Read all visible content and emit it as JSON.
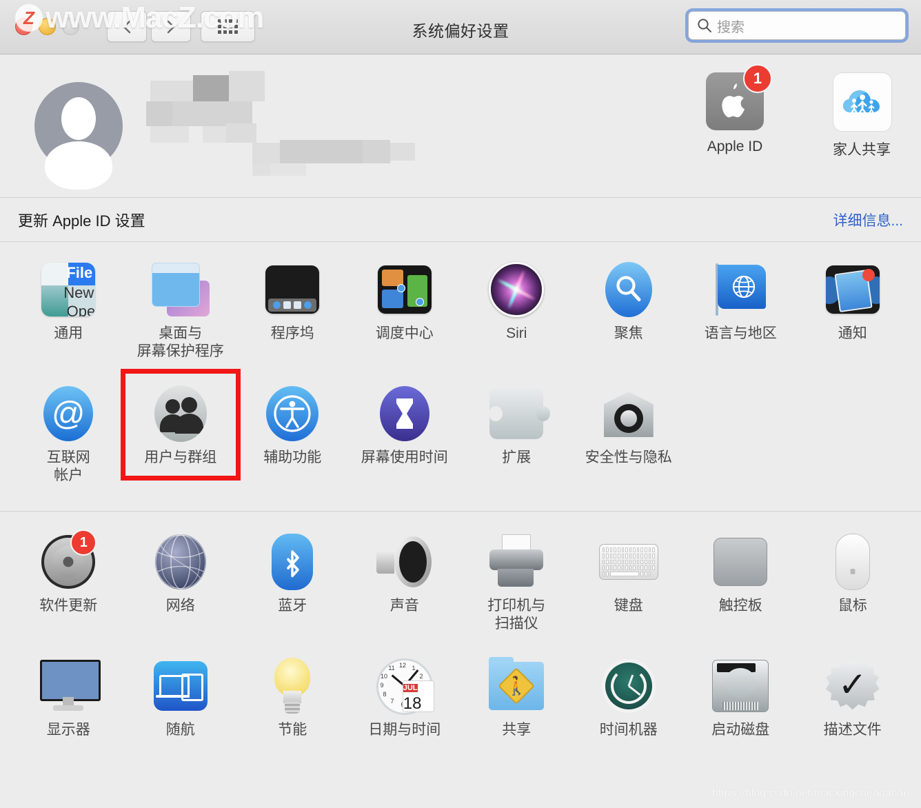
{
  "window": {
    "title": "系统偏好设置",
    "traffic_lights": [
      "close",
      "minimize",
      "zoom"
    ],
    "nav": {
      "back": "‹",
      "forward": "›",
      "show_all": "show-all-grid"
    },
    "search": {
      "placeholder": "搜索",
      "value": ""
    }
  },
  "watermarks": {
    "top": "www.MacZ.com",
    "top_badge": "Z",
    "bottom": "https://blog.csdn.net/macxingchendahai"
  },
  "account": {
    "name_hidden": "",
    "email_hidden": "",
    "items": [
      {
        "label": "Apple ID",
        "icon": "apple-logo-icon",
        "badge": "1"
      },
      {
        "label": "家人共享",
        "icon": "family-sharing-icon",
        "badge": ""
      }
    ]
  },
  "update_banner": {
    "text": "更新 Apple ID 设置",
    "link": "详细信息...",
    "link_color": "#2f62c9"
  },
  "highlight": {
    "target": "用户与群组",
    "color": "#f21616"
  },
  "sections": [
    {
      "id": "personal",
      "rows": [
        [
          {
            "label": "通用",
            "icon": "general-icon"
          },
          {
            "label": "桌面与\n屏幕保护程序",
            "icon": "desktop-screensaver-icon"
          },
          {
            "label": "程序坞",
            "icon": "dock-icon"
          },
          {
            "label": "调度中心",
            "icon": "mission-control-icon"
          },
          {
            "label": "Siri",
            "icon": "siri-icon"
          },
          {
            "label": "聚焦",
            "icon": "spotlight-icon"
          },
          {
            "label": "语言与地区",
            "icon": "language-region-icon"
          },
          {
            "label": "通知",
            "icon": "notifications-icon",
            "badge": "dot"
          }
        ],
        [
          {
            "label": "互联网\n帐户",
            "icon": "internet-accounts-icon"
          },
          {
            "label": "用户与群组",
            "icon": "users-groups-icon",
            "highlighted": true
          },
          {
            "label": "辅助功能",
            "icon": "accessibility-icon"
          },
          {
            "label": "屏幕使用时间",
            "icon": "screen-time-icon"
          },
          {
            "label": "扩展",
            "icon": "extensions-icon"
          },
          {
            "label": "安全性与隐私",
            "icon": "security-privacy-icon"
          }
        ]
      ]
    },
    {
      "id": "hardware",
      "rows": [
        [
          {
            "label": "软件更新",
            "icon": "software-update-icon",
            "badge": "1"
          },
          {
            "label": "网络",
            "icon": "network-icon"
          },
          {
            "label": "蓝牙",
            "icon": "bluetooth-icon"
          },
          {
            "label": "声音",
            "icon": "sound-icon"
          },
          {
            "label": "打印机与\n扫描仪",
            "icon": "printers-scanners-icon"
          },
          {
            "label": "键盘",
            "icon": "keyboard-icon"
          },
          {
            "label": "触控板",
            "icon": "trackpad-icon"
          },
          {
            "label": "鼠标",
            "icon": "mouse-icon"
          }
        ],
        [
          {
            "label": "显示器",
            "icon": "displays-icon"
          },
          {
            "label": "随航",
            "icon": "sidecar-icon"
          },
          {
            "label": "节能",
            "icon": "energy-saver-icon"
          },
          {
            "label": "日期与时间",
            "icon": "date-time-icon",
            "cal_month": "JUL",
            "cal_day": "18"
          },
          {
            "label": "共享",
            "icon": "sharing-icon"
          },
          {
            "label": "时间机器",
            "icon": "time-machine-icon"
          },
          {
            "label": "启动磁盘",
            "icon": "startup-disk-icon"
          },
          {
            "label": "描述文件",
            "icon": "profiles-icon"
          }
        ]
      ]
    }
  ]
}
